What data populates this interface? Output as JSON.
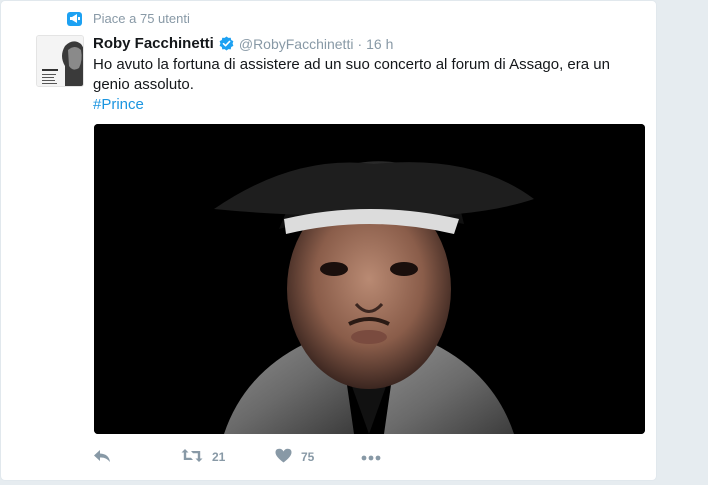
{
  "context": {
    "text": "Piace a 75 utenti",
    "icon": "megaphone-icon"
  },
  "tweet": {
    "author_name": "Roby Facchinetti",
    "verified": true,
    "handle": "@RobyFacchinetti",
    "separator": "·",
    "time": "16 h",
    "text": "Ho avuto la fortuna di assistere ad un suo concerto al forum di Assago, era un genio assoluto.",
    "hashtag": "#Prince"
  },
  "actions": {
    "reply_icon": "reply-icon",
    "retweet_icon": "retweet-icon",
    "retweet_count": "21",
    "like_icon": "heart-icon",
    "like_count": "75",
    "more_icon": "more-icon"
  },
  "colors": {
    "accent": "#1da1f2",
    "link": "#1b95e0",
    "muted": "#8899a6",
    "verified": "#1da1f2"
  }
}
